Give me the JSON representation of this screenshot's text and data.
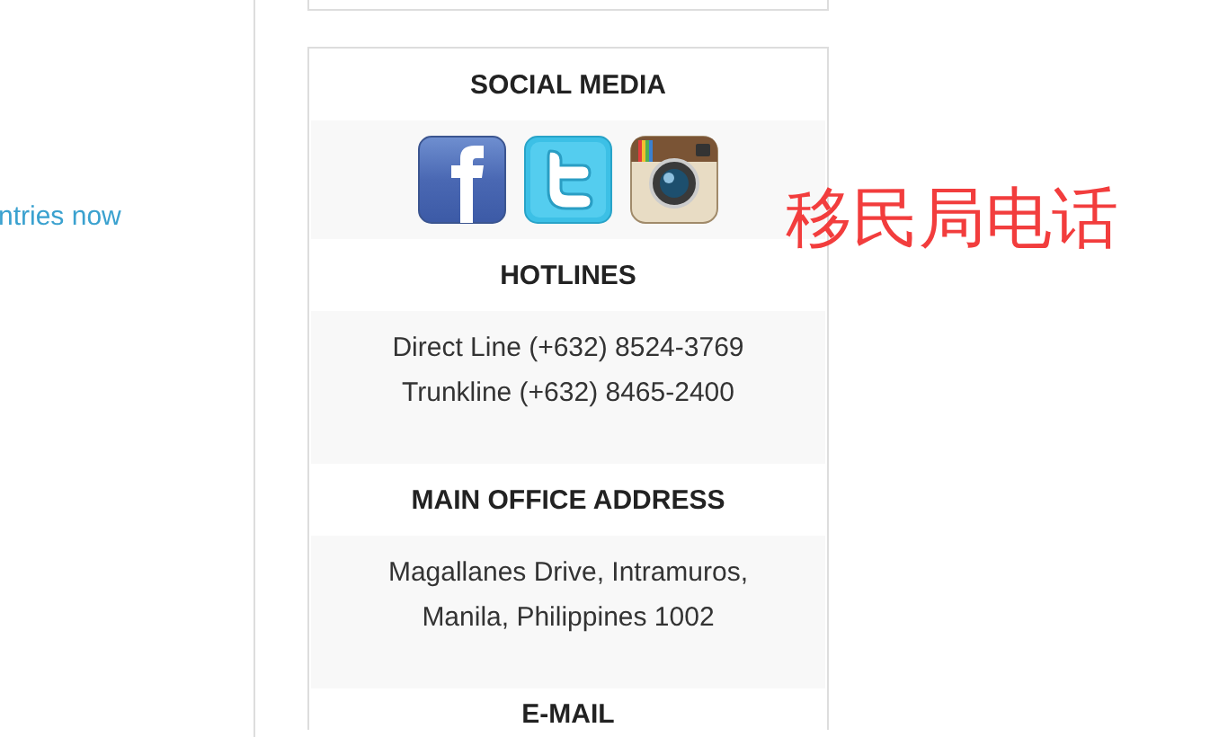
{
  "left_column": {
    "link": "ntries now"
  },
  "sections": [
    {
      "heading": "SOCIAL MEDIA",
      "kind": "social"
    },
    {
      "heading": "HOTLINES",
      "kind": "lines",
      "lines": [
        "Direct Line (+632) 8524-3769",
        "Trunkline (+632) 8465-2400"
      ]
    },
    {
      "heading": "MAIN OFFICE ADDRESS",
      "kind": "lines",
      "lines": [
        "Magallanes Drive, Intramuros,",
        "Manila, Philippines 1002"
      ]
    },
    {
      "heading": "E-MAIL",
      "kind": "heading_only"
    }
  ],
  "annotation": "移民局电话"
}
